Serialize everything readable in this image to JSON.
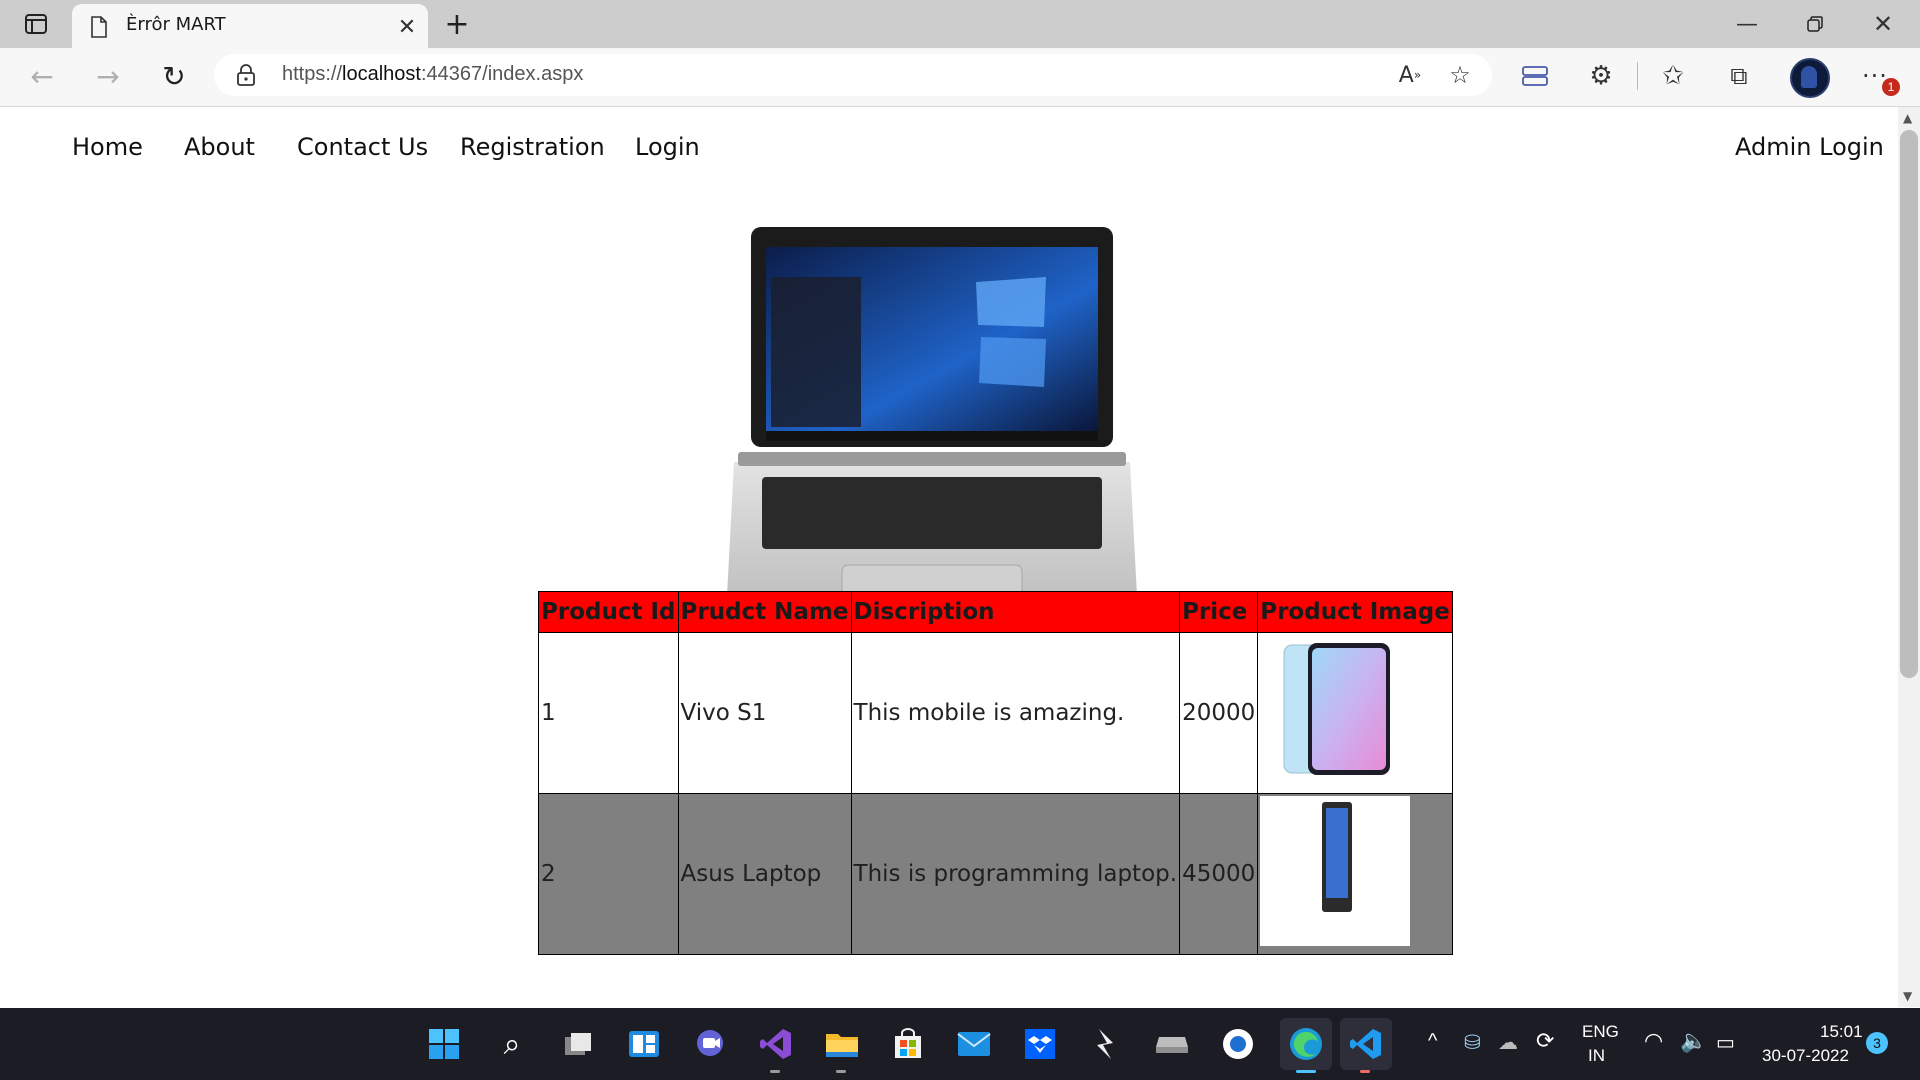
{
  "browser": {
    "tab_title": "Èrrôr MART",
    "url_prefix": "https://",
    "url_host": "localhost",
    "url_rest": ":44367/index.aspx",
    "notification_count": "1"
  },
  "site": {
    "nav": {
      "home": "Home",
      "about": "About",
      "contact": "Contact Us",
      "registration": "Registration",
      "login": "Login",
      "admin_login": "Admin Login"
    },
    "slider_caption": "------------------",
    "carousel": {
      "slides": 3,
      "active_index": 0
    }
  },
  "products_table": {
    "headers": [
      "Product Id",
      "Prudct Name",
      "Discription",
      "Price",
      "Product Image"
    ],
    "rows": [
      {
        "id": "1",
        "name": "Vivo S1",
        "description": "This mobile is amazing.",
        "price": "20000",
        "image": "vivo-s1-phone"
      },
      {
        "id": "2",
        "name": "Asus Laptop",
        "description": "This is programming laptop.",
        "price": "45000",
        "image": "asus-laptop"
      }
    ]
  },
  "taskbar": {
    "lang_line1": "ENG",
    "lang_line2": "IN",
    "time": "15:01",
    "date": "30-07-2022",
    "notifications": "3"
  },
  "colors": {
    "table_header": "#ff0000",
    "alt_row": "#808080",
    "taskbar": "#1c1c24",
    "carousel_active": "#1a1aff",
    "carousel_inactive": "#8a8aff"
  }
}
